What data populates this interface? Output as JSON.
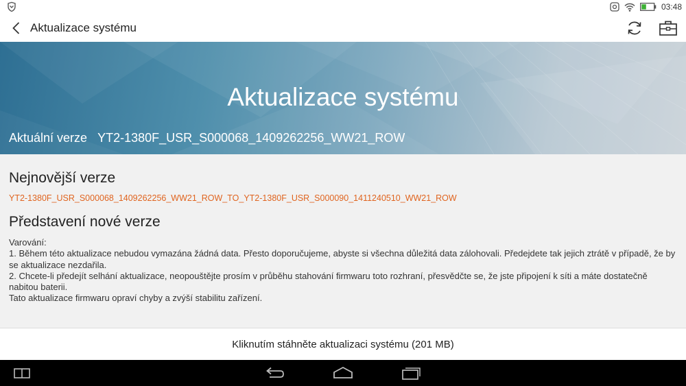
{
  "status_bar": {
    "time": "03:48",
    "icons": [
      "notification-shield-icon",
      "data-saver-icon",
      "wifi-icon",
      "battery-icon"
    ],
    "battery_color": "#3cb034"
  },
  "app_bar": {
    "title": "Aktualizace systému",
    "back_icon": "back-chevron-icon",
    "refresh_icon": "refresh-icon",
    "briefcase_icon": "briefcase-icon"
  },
  "hero": {
    "title": "Aktualizace systému",
    "current_label": "Aktuální verze",
    "current_value": "YT2-1380F_USR_S000068_1409262256_WW21_ROW"
  },
  "latest": {
    "heading": "Nejnovější verze",
    "value": "YT2-1380F_USR_S000068_1409262256_WW21_ROW_TO_YT2-1380F_USR_S000090_1411240510_WW21_ROW",
    "accent_color": "#e0641f"
  },
  "release_notes": {
    "heading": "Představení nové verze",
    "lines": [
      "Varování:",
      "1. Během této aktualizace nebudou vymazána žádná data. Přesto doporučujeme, abyste si všechna důležitá data zálohovali. Předejdete tak jejich ztrátě v případě, že by se aktualizace nezdařila.",
      "2. Chcete-li předejít selhání aktualizace, neopouštějte prosím v průběhu stahování firmwaru toto rozhraní, přesvědčte se, že jste připojení k síti a máte dostatečně nabitou baterii.",
      "Tato aktualizace firmwaru opraví chyby a zvýší stabilitu zařízení."
    ]
  },
  "download": {
    "label": "Kliknutím stáhněte aktualizaci systému (201 MB)"
  },
  "nav_bar": {
    "icons": [
      "split-screen-icon",
      "back-icon",
      "home-icon",
      "recent-apps-icon"
    ]
  }
}
